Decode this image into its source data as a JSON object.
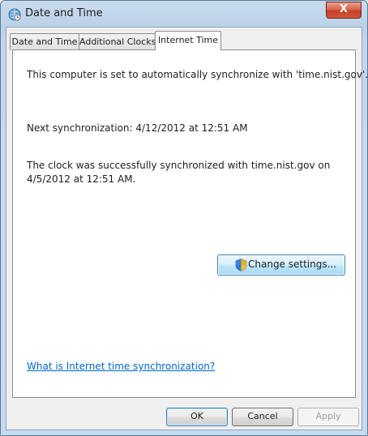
{
  "window": {
    "title": "Date and Time",
    "close_label": "X"
  },
  "tabs": [
    {
      "label": "Date and Time"
    },
    {
      "label": "Additional Clocks"
    },
    {
      "label": "Internet Time"
    }
  ],
  "panel": {
    "auto_sync_text": "This computer is set to automatically synchronize with 'time.nist.gov'.",
    "next_sync_text": "Next synchronization: 4/12/2012 at 12:51 AM",
    "success_line1": "The clock was successfully synchronized with time.nist.gov on",
    "success_line2": "4/5/2012 at 12:51 AM.",
    "change_settings_label": "Change settings...",
    "help_link": "What is Internet time synchronization?"
  },
  "buttons": {
    "ok": "OK",
    "cancel": "Cancel",
    "apply": "Apply"
  },
  "colors": {
    "link": "#0066cc",
    "close_button": "#c33e26",
    "accent_border": "#3c7fb1"
  },
  "icons": {
    "title": "clock-globe-icon",
    "change_settings": "uac-shield-icon"
  },
  "state": {
    "active_tab": "Internet Time",
    "apply_enabled": false
  }
}
